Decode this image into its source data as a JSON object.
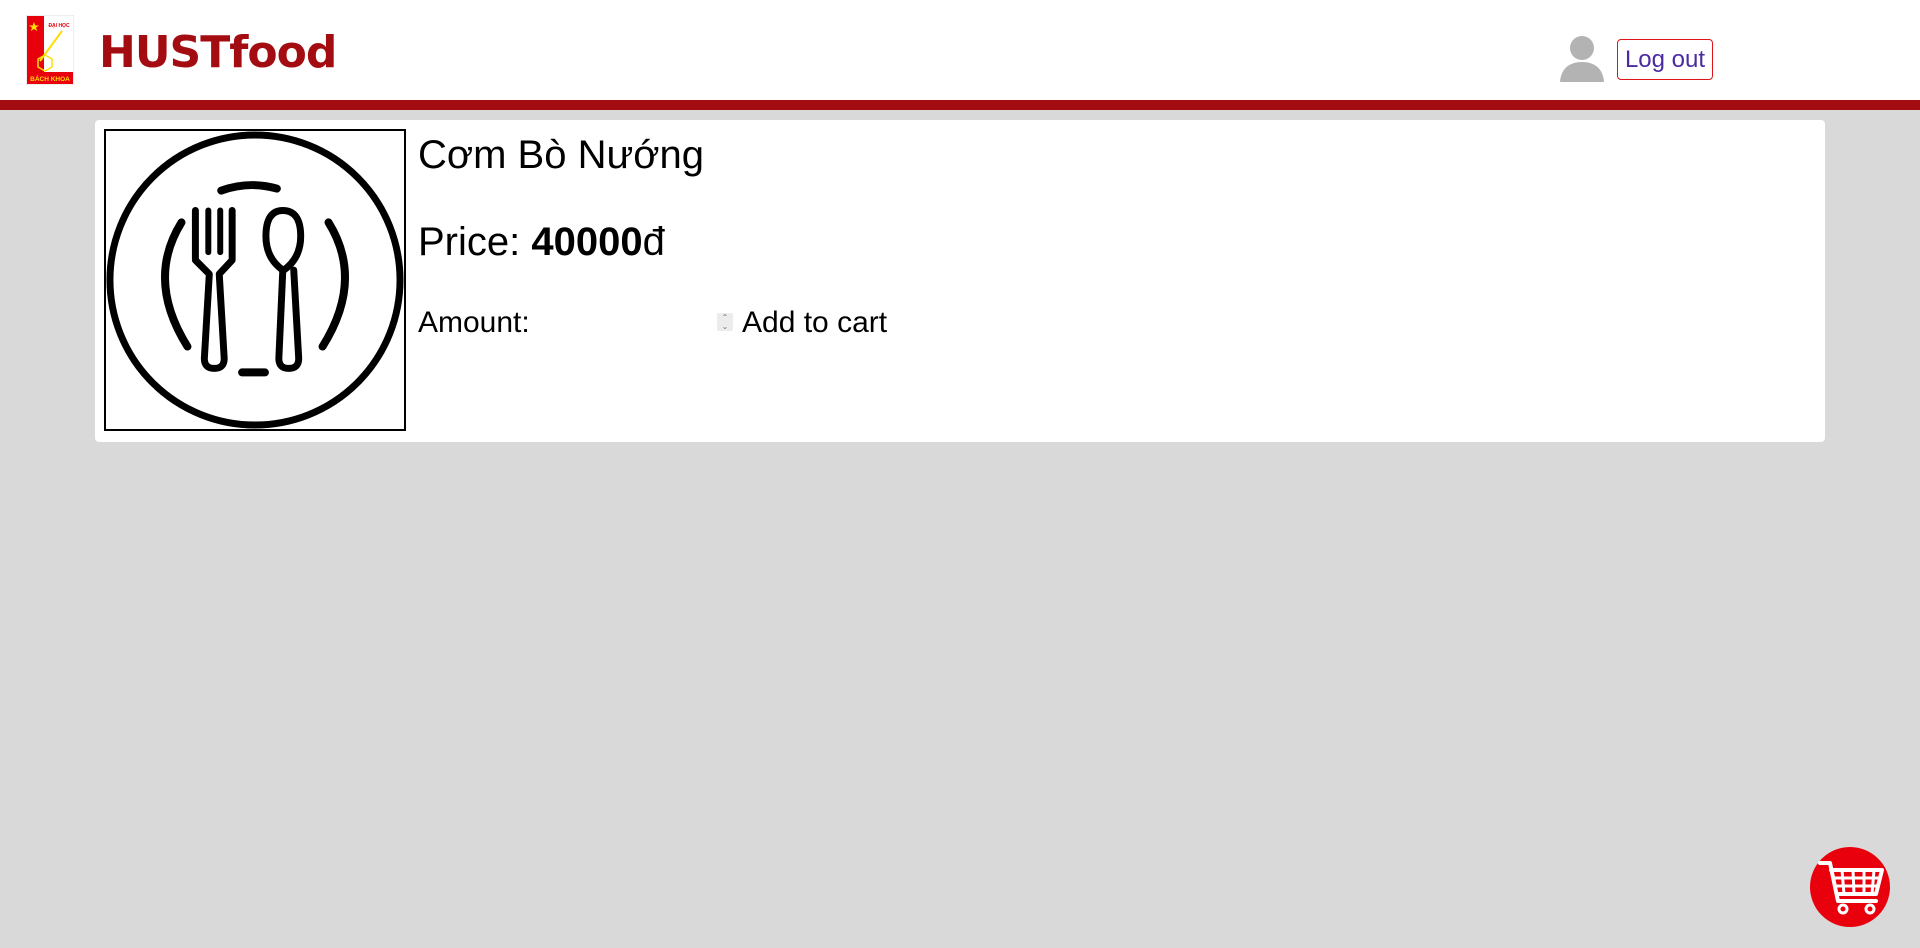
{
  "header": {
    "logo_top_text": "ĐẠI HỌC",
    "logo_bottom_text": "BÁCH KHOA",
    "brand": "HUSTfood",
    "avatar_icon": "user-avatar-icon",
    "logout_label": "Log out"
  },
  "product": {
    "name": "Cơm Bò Nướng",
    "price_label": "Price: ",
    "price_value": "40000",
    "currency": "đ",
    "image_icon": "fork-spoon-plate-icon",
    "amount_label": "Amount:",
    "amount_value": "",
    "add_to_cart_label": "Add to cart"
  },
  "cart_button": {
    "icon": "shopping-cart-icon"
  },
  "colors": {
    "brand_red": "#a30d12",
    "cart_red": "#e8000c",
    "background": "#d9d9d9",
    "logout_text": "#4b2aa2"
  }
}
